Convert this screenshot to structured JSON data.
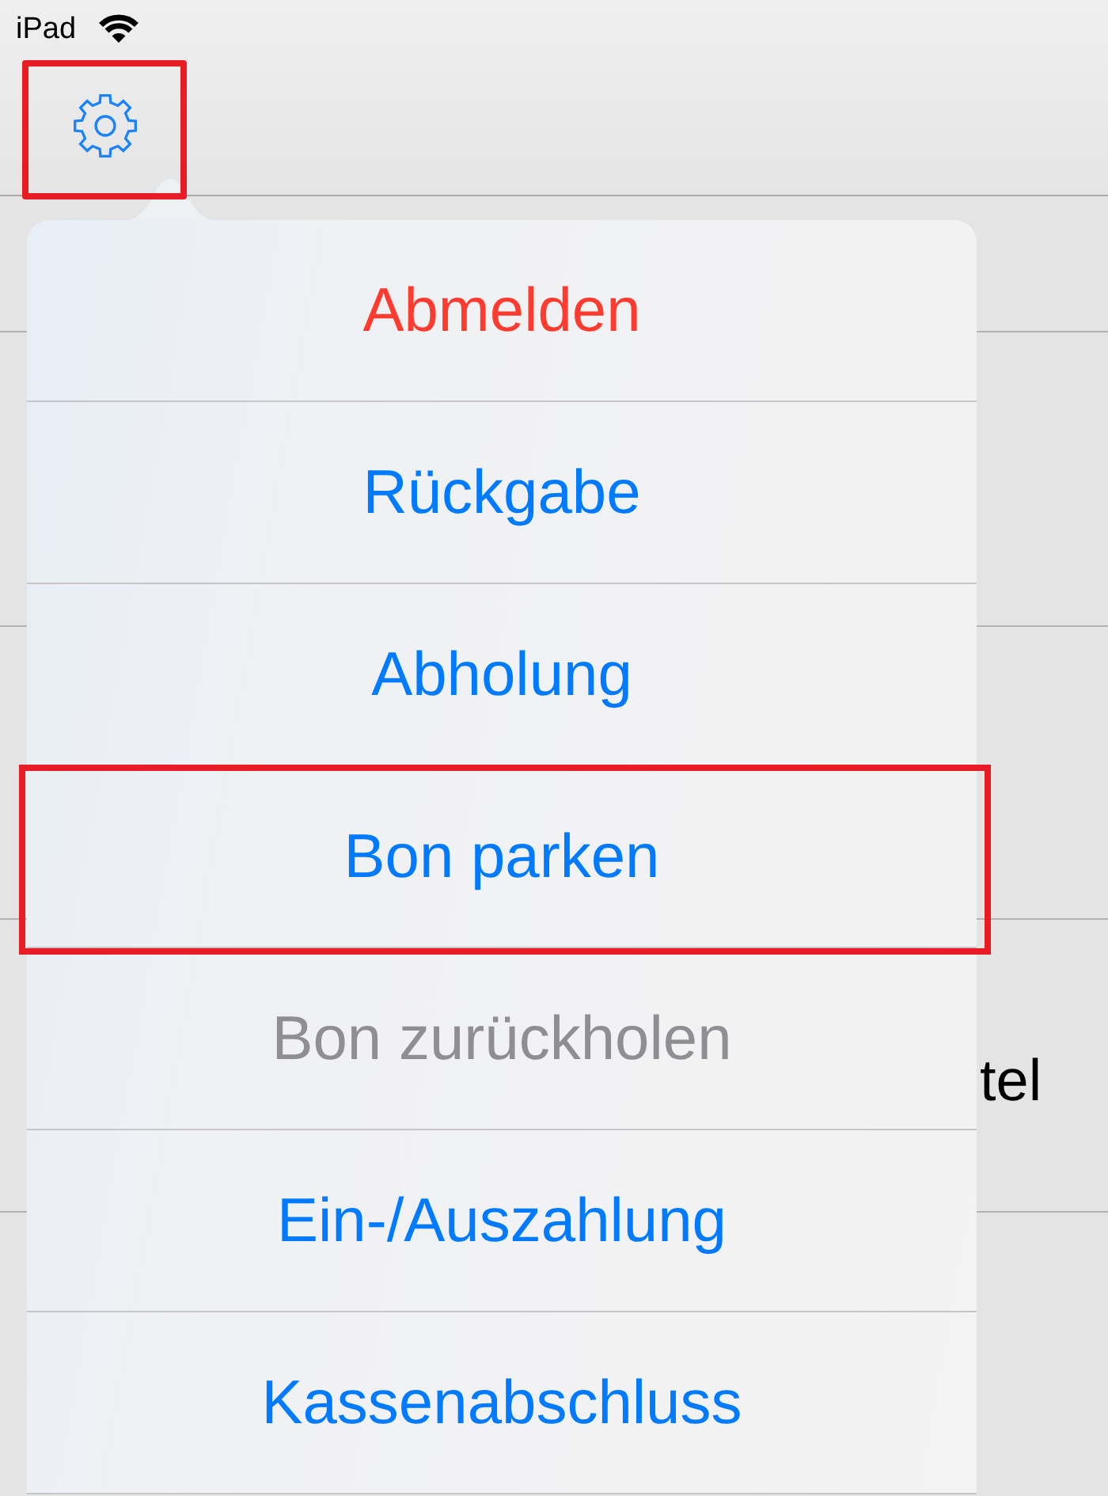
{
  "status_bar": {
    "device_name": "iPad"
  },
  "nav_bar": {
    "settings_button": {
      "highlighted": true
    }
  },
  "background": {
    "partly_hidden_label": "tel"
  },
  "menu": {
    "items": [
      {
        "label": "Abmelden",
        "kind": "destructive",
        "disabled": false,
        "highlighted": false
      },
      {
        "label": "Rückgabe",
        "kind": "default",
        "disabled": false,
        "highlighted": false
      },
      {
        "label": "Abholung",
        "kind": "default",
        "disabled": false,
        "highlighted": false
      },
      {
        "label": "Bon parken",
        "kind": "default",
        "disabled": false,
        "highlighted": true
      },
      {
        "label": "Bon zurückholen",
        "kind": "default",
        "disabled": true,
        "highlighted": false
      },
      {
        "label": "Ein-/Auszahlung",
        "kind": "default",
        "disabled": false,
        "highlighted": false
      },
      {
        "label": "Kassenabschluss",
        "kind": "default",
        "disabled": false,
        "highlighted": false
      }
    ]
  }
}
